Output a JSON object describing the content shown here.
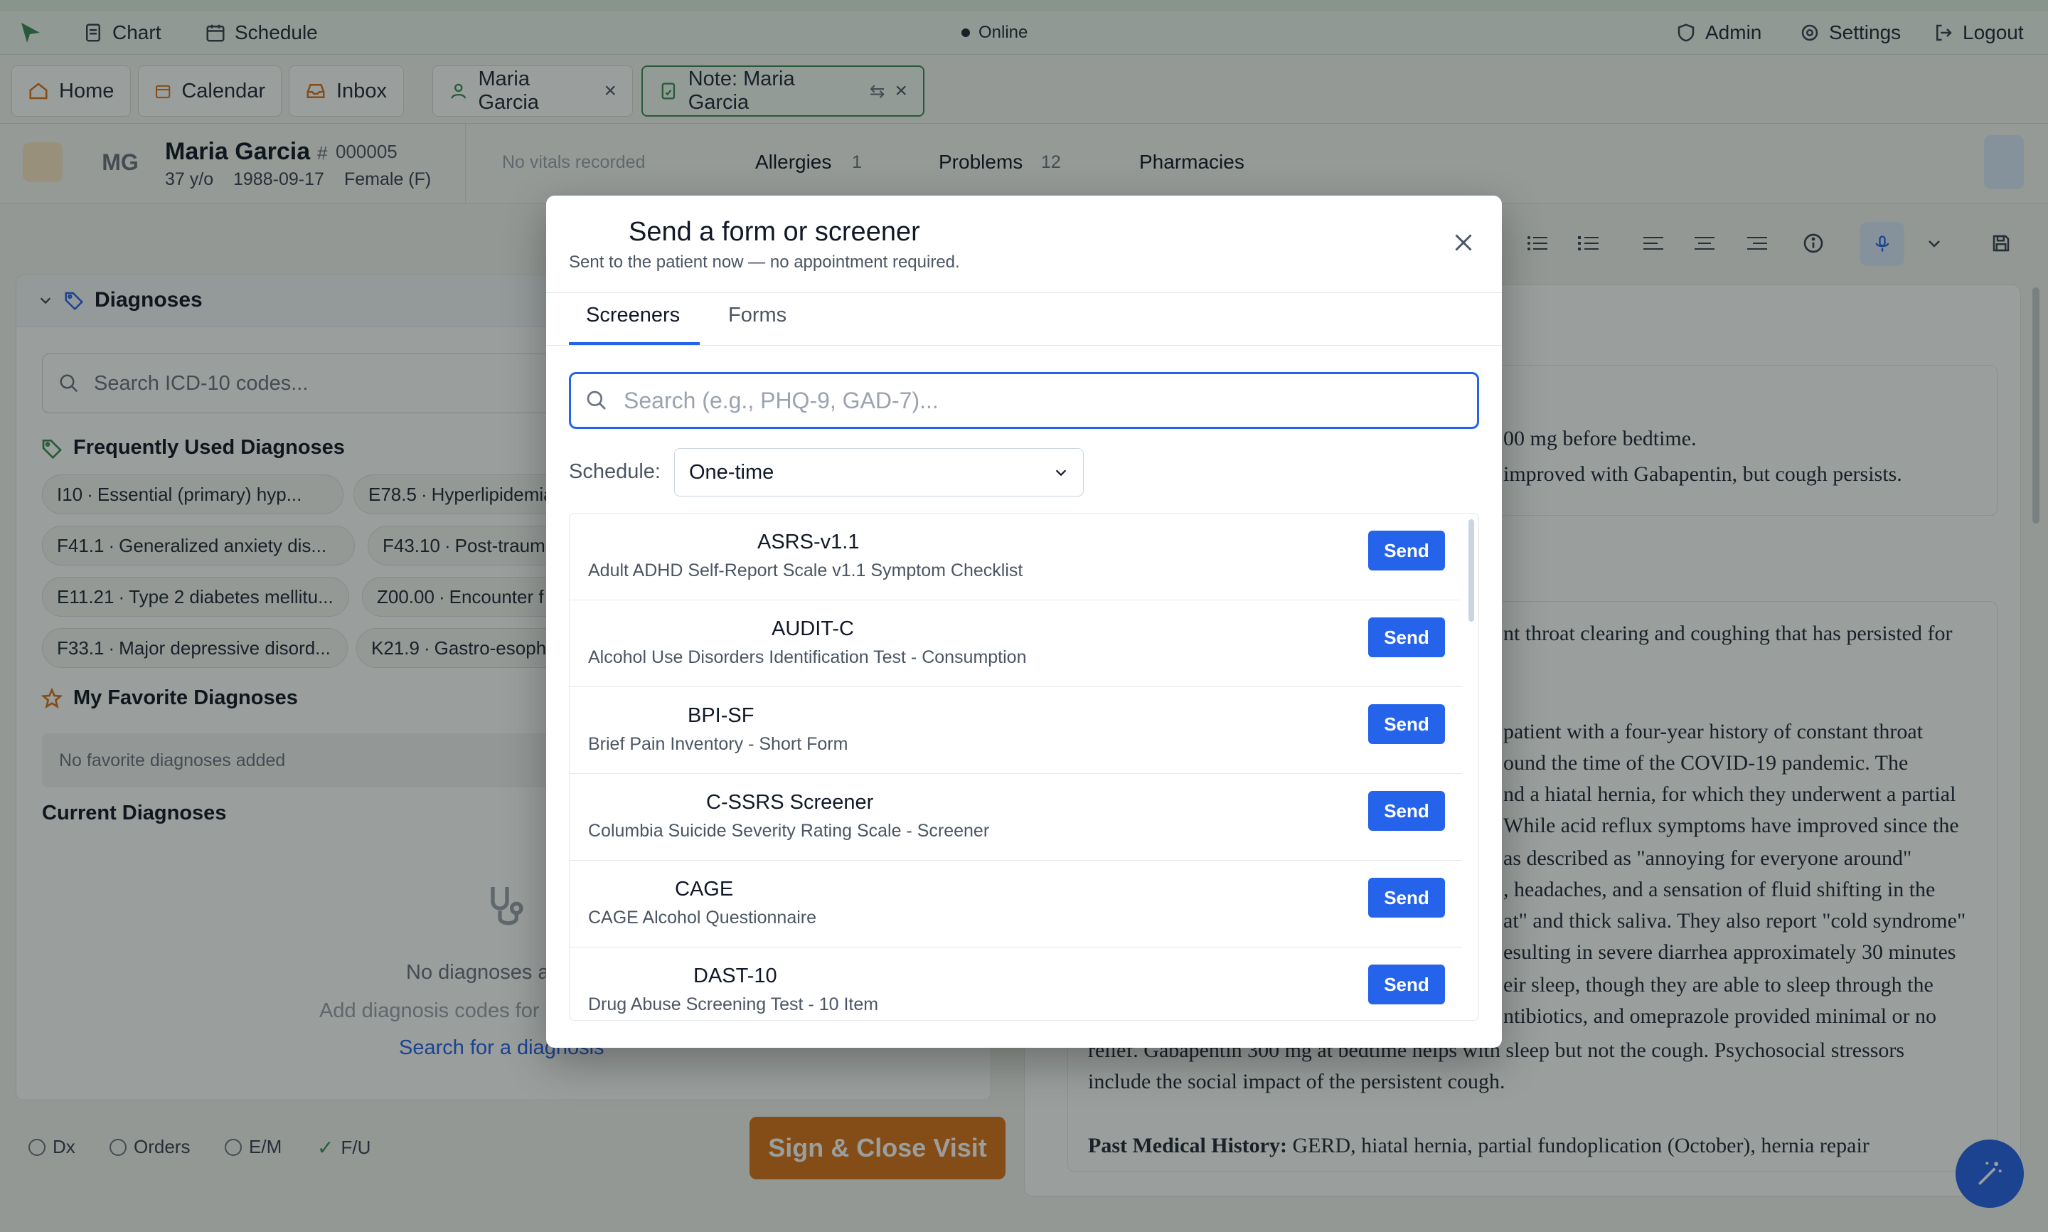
{
  "topbar": {
    "chart": "Chart",
    "schedule": "Schedule",
    "status": "Online",
    "admin": "Admin",
    "settings": "Settings",
    "logout": "Logout"
  },
  "tabs": {
    "home": "Home",
    "calendar": "Calendar",
    "inbox": "Inbox",
    "patient": "Maria Garcia",
    "note": "Note: Maria Garcia"
  },
  "patient": {
    "initials": "MG",
    "name": "Maria Garcia",
    "mrn": "000005",
    "age": "37 y/o",
    "dob": "1988-09-17",
    "sex": "Female (F)",
    "vitals": "No vitals recorded",
    "allergies_label": "Allergies",
    "allergies_count": "1",
    "problems_label": "Problems",
    "problems_count": "12",
    "pharmacies_label": "Pharmacies"
  },
  "diagnoses": {
    "title": "Diagnoses",
    "search_placeholder": "Search ICD-10 codes...",
    "frequent_title": "Frequently Used Diagnoses",
    "frequent": [
      {
        "code": "I10",
        "label": "Essential (primary) hyp..."
      },
      {
        "code": "E78.5",
        "label": "Hyperlipidemia,"
      },
      {
        "code": "F41.1",
        "label": "Generalized anxiety dis..."
      },
      {
        "code": "F43.10",
        "label": "Post-traumat"
      },
      {
        "code": "E11.21",
        "label": "Type 2 diabetes mellitu..."
      },
      {
        "code": "Z00.00",
        "label": "Encounter f"
      },
      {
        "code": "F33.1",
        "label": "Major depressive disord..."
      },
      {
        "code": "K21.9",
        "label": "Gastro-esoph"
      }
    ],
    "favorites_title": "My Favorite Diagnoses",
    "favorites_empty": "No favorite diagnoses added",
    "current_title": "Current Diagnoses",
    "current_empty": "No diagnoses a",
    "current_hint": "Add diagnosis codes for",
    "current_link": "Search for a diagnosis"
  },
  "note_text": {
    "l1": "00 mg before bedtime.",
    "l2": "improved with Gabapentin, but cough persists.",
    "l3": "nt throat clearing and coughing that has persisted for",
    "l4": "patient with a four-year history of constant throat",
    "l5": "ound the time of the COVID-19 pandemic. The",
    "l6": "nd a hiatal hernia, for which they underwent a partial",
    "l7": "While acid reflux symptoms have improved since the",
    "l8": "as described as \"annoying for everyone around\"",
    "l9": ", headaches, and a sensation of fluid shifting in the",
    "l10": "at\" and thick saliva. They also report \"cold syndrome\"",
    "l11": "esulting in severe diarrhea approximately 30 minutes",
    "l12": "eir sleep, though they are able to sleep through the",
    "l13": "ntibiotics, and omeprazole provided minimal or no",
    "l14": "relief. Gabapentin 300 mg at bedtime helps with sleep but not the cough. Psychosocial stressors",
    "l15": "include the social impact of the persistent cough.",
    "l16_bold": "Past Medical History:",
    "l16": " GERD, hiatal hernia, partial fundoplication (October), hernia repair"
  },
  "bottom": {
    "dx": "Dx",
    "orders": "Orders",
    "em": "E/M",
    "fu": "F/U",
    "sign": "Sign & Close Visit"
  },
  "modal": {
    "title": "Send a form or screener",
    "subtitle": "Sent to the patient now — no appointment required.",
    "tab_screeners": "Screeners",
    "tab_forms": "Forms",
    "search_placeholder": "Search (e.g., PHQ-9, GAD-7)...",
    "schedule_label": "Schedule:",
    "schedule_value": "One-time",
    "send_label": "Send",
    "items": [
      {
        "name": "ASRS-v1.1",
        "desc": "Adult ADHD Self-Report Scale v1.1 Symptom Checklist"
      },
      {
        "name": "AUDIT-C",
        "desc": "Alcohol Use Disorders Identification Test - Consumption"
      },
      {
        "name": "BPI-SF",
        "desc": "Brief Pain Inventory - Short Form"
      },
      {
        "name": "C-SSRS Screener",
        "desc": "Columbia Suicide Severity Rating Scale - Screener"
      },
      {
        "name": "CAGE",
        "desc": "CAGE Alcohol Questionnaire"
      },
      {
        "name": "DAST-10",
        "desc": "Drug Abuse Screening Test - 10 Item"
      }
    ]
  },
  "colors": {
    "accent": "#2563eb",
    "brand_green": "#3b8a55",
    "sign_orange": "#d9731a"
  }
}
